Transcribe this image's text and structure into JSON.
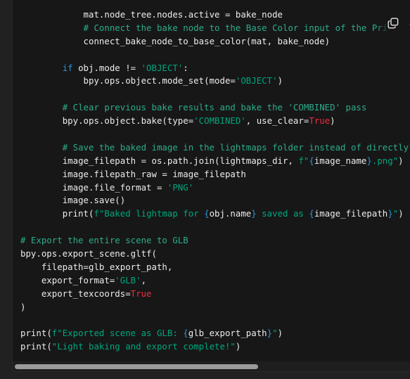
{
  "code": {
    "lines": [
      {
        "indent": "            ",
        "segments": [
          {
            "t": "mat.node_tree.nodes.active = bake_node",
            "c": ""
          }
        ]
      },
      {
        "indent": "            ",
        "segments": [
          {
            "t": "# Connect the bake node to the Base Color input of the Principled BSDF",
            "c": "c"
          }
        ]
      },
      {
        "indent": "            ",
        "segments": [
          {
            "t": "connect_bake_node_to_base_color(mat, bake_node)",
            "c": ""
          }
        ]
      },
      {
        "indent": "",
        "segments": []
      },
      {
        "indent": "        ",
        "segments": [
          {
            "t": "if",
            "c": "k"
          },
          {
            "t": " obj.mode != ",
            "c": ""
          },
          {
            "t": "'OBJECT'",
            "c": "s"
          },
          {
            "t": ":",
            "c": ""
          }
        ]
      },
      {
        "indent": "            ",
        "segments": [
          {
            "t": "bpy.ops.object.mode_set(mode=",
            "c": ""
          },
          {
            "t": "'OBJECT'",
            "c": "s"
          },
          {
            "t": ")",
            "c": ""
          }
        ]
      },
      {
        "indent": "",
        "segments": []
      },
      {
        "indent": "        ",
        "segments": [
          {
            "t": "# Clear previous bake results and bake the 'COMBINED' pass",
            "c": "c"
          }
        ]
      },
      {
        "indent": "        ",
        "segments": [
          {
            "t": "bpy.ops.object.bake(type=",
            "c": ""
          },
          {
            "t": "'COMBINED'",
            "c": "s"
          },
          {
            "t": ", use_clear=",
            "c": ""
          },
          {
            "t": "True",
            "c": "b"
          },
          {
            "t": ")",
            "c": ""
          }
        ]
      },
      {
        "indent": "",
        "segments": []
      },
      {
        "indent": "        ",
        "segments": [
          {
            "t": "# Save the baked image in the lightmaps folder instead of directly",
            "c": "c"
          }
        ]
      },
      {
        "indent": "        ",
        "segments": [
          {
            "t": "image_filepath = os.path.join(lightmaps_dir, ",
            "c": ""
          },
          {
            "t": "f\"",
            "c": "s"
          },
          {
            "t": "{",
            "c": "k"
          },
          {
            "t": "image_name",
            "c": ""
          },
          {
            "t": "}",
            "c": "k"
          },
          {
            "t": ".png\"",
            "c": "s"
          },
          {
            "t": ")",
            "c": ""
          }
        ]
      },
      {
        "indent": "        ",
        "segments": [
          {
            "t": "image.filepath_raw = image_filepath",
            "c": ""
          }
        ]
      },
      {
        "indent": "        ",
        "segments": [
          {
            "t": "image.file_format = ",
            "c": ""
          },
          {
            "t": "'PNG'",
            "c": "s"
          }
        ]
      },
      {
        "indent": "        ",
        "segments": [
          {
            "t": "image.save()",
            "c": ""
          }
        ]
      },
      {
        "indent": "        ",
        "segments": [
          {
            "t": "print",
            "c": ""
          },
          {
            "t": "(",
            "c": ""
          },
          {
            "t": "f\"Baked lightmap for ",
            "c": "s"
          },
          {
            "t": "{",
            "c": "k"
          },
          {
            "t": "obj.name",
            "c": ""
          },
          {
            "t": "}",
            "c": "k"
          },
          {
            "t": " saved as ",
            "c": "s"
          },
          {
            "t": "{",
            "c": "k"
          },
          {
            "t": "image_filepath",
            "c": ""
          },
          {
            "t": "}",
            "c": "k"
          },
          {
            "t": "\"",
            "c": "s"
          },
          {
            "t": ")",
            "c": ""
          }
        ]
      },
      {
        "indent": "",
        "segments": []
      },
      {
        "indent": "",
        "segments": [
          {
            "t": "# Export the entire scene to GLB",
            "c": "c"
          }
        ]
      },
      {
        "indent": "",
        "segments": [
          {
            "t": "bpy.ops.export_scene.gltf(",
            "c": ""
          }
        ]
      },
      {
        "indent": "    ",
        "segments": [
          {
            "t": "filepath=glb_export_path,",
            "c": ""
          }
        ]
      },
      {
        "indent": "    ",
        "segments": [
          {
            "t": "export_format=",
            "c": ""
          },
          {
            "t": "'GLB'",
            "c": "s"
          },
          {
            "t": ",",
            "c": ""
          }
        ]
      },
      {
        "indent": "    ",
        "segments": [
          {
            "t": "export_texcoords=",
            "c": ""
          },
          {
            "t": "True",
            "c": "b"
          }
        ]
      },
      {
        "indent": "",
        "segments": [
          {
            "t": ")",
            "c": ""
          }
        ]
      },
      {
        "indent": "",
        "segments": []
      },
      {
        "indent": "",
        "segments": [
          {
            "t": "print",
            "c": ""
          },
          {
            "t": "(",
            "c": ""
          },
          {
            "t": "f\"Exported scene as GLB: ",
            "c": "s"
          },
          {
            "t": "{",
            "c": "k"
          },
          {
            "t": "glb_export_path",
            "c": ""
          },
          {
            "t": "}",
            "c": "k"
          },
          {
            "t": "\"",
            "c": "s"
          },
          {
            "t": ")",
            "c": ""
          }
        ]
      },
      {
        "indent": "",
        "segments": [
          {
            "t": "print",
            "c": ""
          },
          {
            "t": "(",
            "c": ""
          },
          {
            "t": "\"Light baking and export complete!\"",
            "c": "s"
          },
          {
            "t": ")",
            "c": ""
          }
        ]
      }
    ]
  },
  "copy_button": {
    "icon": "copy-icon"
  },
  "colors": {
    "background": "#212121",
    "code_background": "#171717",
    "comment": "#2dac8b",
    "string": "#00a67d",
    "keyword": "#2e95d3",
    "boolean": "#f22c3d",
    "text": "#ececec"
  }
}
